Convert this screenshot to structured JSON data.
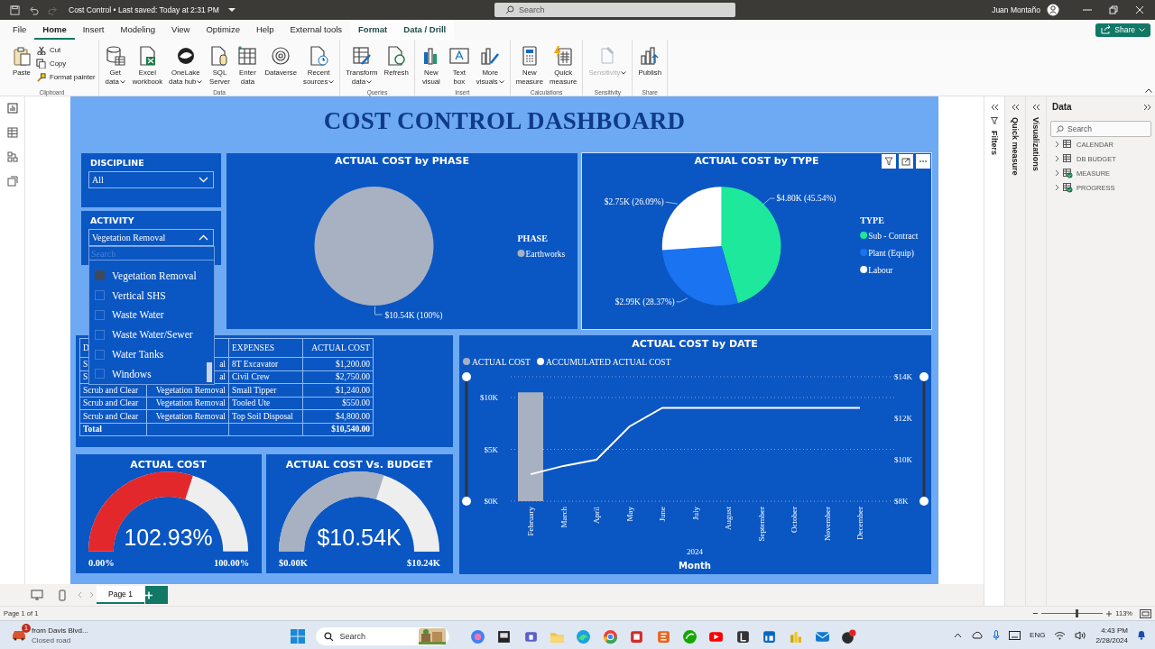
{
  "window": {
    "title": "Cost Control • Last saved: Today at 2:31 PM",
    "search_placeholder": "Search",
    "user": "Juan Montaño"
  },
  "menu_tabs": [
    {
      "label": "File",
      "selected": false,
      "contextual": false
    },
    {
      "label": "Home",
      "selected": true,
      "contextual": false
    },
    {
      "label": "Insert",
      "selected": false,
      "contextual": false
    },
    {
      "label": "Modeling",
      "selected": false,
      "contextual": false
    },
    {
      "label": "View",
      "selected": false,
      "contextual": false
    },
    {
      "label": "Optimize",
      "selected": false,
      "contextual": false
    },
    {
      "label": "Help",
      "selected": false,
      "contextual": false
    },
    {
      "label": "External tools",
      "selected": false,
      "contextual": false
    },
    {
      "label": "Format",
      "selected": false,
      "contextual": true
    },
    {
      "label": "Data / Drill",
      "selected": false,
      "contextual": true
    }
  ],
  "share_button": "Share",
  "ribbon_groups": [
    {
      "name": "Clipboard",
      "buttons": [
        {
          "label": "Paste",
          "kind": "large",
          "menu": false,
          "disabled": false
        },
        {
          "label": "Cut",
          "kind": "small",
          "menu": false,
          "disabled": false
        },
        {
          "label": "Copy",
          "kind": "small",
          "menu": false,
          "disabled": false
        },
        {
          "label": "Format painter",
          "kind": "small",
          "menu": false,
          "disabled": false
        }
      ]
    },
    {
      "name": "Data",
      "buttons": [
        {
          "label": "Get\ndata",
          "kind": "large",
          "menu": true,
          "disabled": false
        },
        {
          "label": "Excel\nworkbook",
          "kind": "large",
          "menu": false,
          "disabled": false
        },
        {
          "label": "OneLake\ndata hub",
          "kind": "large",
          "menu": true,
          "disabled": false
        },
        {
          "label": "SQL\nServer",
          "kind": "large",
          "menu": false,
          "disabled": false
        },
        {
          "label": "Enter\ndata",
          "kind": "large",
          "menu": false,
          "disabled": false
        },
        {
          "label": "Dataverse",
          "kind": "large",
          "menu": false,
          "disabled": false
        },
        {
          "label": "Recent\nsources",
          "kind": "large",
          "menu": true,
          "disabled": false
        }
      ]
    },
    {
      "name": "Queries",
      "buttons": [
        {
          "label": "Transform\ndata",
          "kind": "large",
          "menu": true,
          "disabled": false
        },
        {
          "label": "Refresh",
          "kind": "large",
          "menu": false,
          "disabled": false
        }
      ]
    },
    {
      "name": "Insert",
      "buttons": [
        {
          "label": "New\nvisual",
          "kind": "large",
          "menu": false,
          "disabled": false
        },
        {
          "label": "Text\nbox",
          "kind": "large",
          "menu": false,
          "disabled": false
        },
        {
          "label": "More\nvisuals",
          "kind": "large",
          "menu": true,
          "disabled": false
        }
      ]
    },
    {
      "name": "Calculations",
      "buttons": [
        {
          "label": "New\nmeasure",
          "kind": "large",
          "menu": false,
          "disabled": false
        },
        {
          "label": "Quick\nmeasure",
          "kind": "large",
          "menu": false,
          "disabled": false
        }
      ]
    },
    {
      "name": "Sensitivity",
      "buttons": [
        {
          "label": "Sensitivity",
          "kind": "large",
          "menu": true,
          "disabled": true
        }
      ]
    },
    {
      "name": "Share",
      "buttons": [
        {
          "label": "Publish",
          "kind": "large",
          "menu": false,
          "disabled": false
        }
      ]
    }
  ],
  "report": {
    "title": "COST CONTROL DASHBOARD",
    "slicers": [
      {
        "title": "DISCIPLINE",
        "value": "All",
        "expanded": false
      },
      {
        "title": "ACTIVITY",
        "value": "Vegetation Removal",
        "expanded": true,
        "search_placeholder": "Search",
        "options": [
          {
            "label": "Vegetation Removal",
            "checked": true
          },
          {
            "label": "Vertical SHS",
            "checked": false
          },
          {
            "label": "Waste Water",
            "checked": false
          },
          {
            "label": "Waste Water/Sewer",
            "checked": false
          },
          {
            "label": "Water Tanks",
            "checked": false
          },
          {
            "label": "Windows",
            "checked": false
          }
        ]
      }
    ],
    "pie_visuals": [
      {
        "focused": false,
        "chart_data": {
          "type": "pie",
          "title": "ACTUAL COST by PHASE",
          "categories": [
            "Earthworks"
          ],
          "values": [
            100
          ],
          "colors": [
            "#a7b1c2"
          ],
          "value_labels": [
            "$10.54K (100%)"
          ],
          "legend": {
            "title": "PHASE"
          }
        }
      },
      {
        "focused": true,
        "chart_data": {
          "type": "pie",
          "title": "ACTUAL COST by TYPE",
          "categories": [
            "Sub - Contract",
            "Plant (Equip)",
            "Labour"
          ],
          "values": [
            45.54,
            28.37,
            26.09
          ],
          "colors": [
            "#1de89b",
            "#1a73f0",
            "#ffffff"
          ],
          "value_labels": [
            "$4.80K (45.54%)",
            "$2.99K (28.37%)",
            "$2.75K (26.09%)"
          ],
          "legend": {
            "title": "TYPE"
          }
        }
      }
    ],
    "table": {
      "columns": [
        "D",
        "",
        "EXPENSES",
        "ACTUAL COST"
      ],
      "rows": [
        [
          "S",
          "al",
          "8T Excavator",
          "$1,200.00"
        ],
        [
          "S",
          "al",
          "Civil Crew",
          "$2,750.00"
        ],
        [
          "Scrub and Clear",
          "Vegetation Removal",
          "Small Tipper",
          "$1,240.00"
        ],
        [
          "Scrub and Clear",
          "Vegetation Removal",
          "Tooled Ute",
          "$550.00"
        ],
        [
          "Scrub and Clear",
          "Vegetation Removal",
          "Top Soil Disposal",
          "$4,800.00"
        ]
      ],
      "total": {
        "label": "Total",
        "value": "$10,540.00"
      }
    },
    "gauges": [
      {
        "title": "ACTUAL COST",
        "value": "102.93%",
        "min": "0.00%",
        "max": "100.00%",
        "level": 0.6,
        "color": "#e3282b"
      },
      {
        "title": "ACTUAL COST Vs. BUDGET",
        "value": "$10.54K",
        "min": "$0.00K",
        "max": "$10.24K",
        "level": 0.6,
        "color": "#a7b1c2"
      }
    ],
    "date_chart": {
      "year_label": "2024",
      "chart_data": {
        "type": "bar",
        "title": "ACTUAL COST by DATE",
        "xlabel": "Month",
        "categories": [
          "February",
          "March",
          "April",
          "May",
          "June",
          "July",
          "August",
          "September",
          "October",
          "November",
          "December"
        ],
        "series": [
          {
            "name": "ACTUAL COST",
            "color": "#a7b1c2",
            "type": "bar",
            "values": [
              10.5,
              null,
              null,
              null,
              null,
              null,
              null,
              null,
              null,
              null,
              null
            ]
          },
          {
            "name": "ACCUMULATED ACTUAL COST",
            "color": "#ffffff",
            "axis": "y2",
            "type": "line",
            "values": [
              9.3,
              9.7,
              10.0,
              11.6,
              12.5,
              12.5,
              12.5,
              12.5,
              12.5,
              12.5,
              12.5
            ]
          }
        ],
        "legend": "top",
        "ylim": [
          0,
          12
        ],
        "y2lim": [
          8,
          14
        ],
        "yticks": [
          {
            "value": 0,
            "label": "$0K"
          },
          {
            "value": 5,
            "label": "$5K"
          },
          {
            "value": 10,
            "label": "$10K"
          }
        ],
        "y2ticks": [
          {
            "value": 8,
            "label": "$8K"
          },
          {
            "value": 10,
            "label": "$10K"
          },
          {
            "value": 12,
            "label": "$12K"
          },
          {
            "value": 14,
            "label": "$14K"
          }
        ]
      }
    }
  },
  "collapsed_panes": [
    "Filters",
    "Quick measure",
    "Visualizations"
  ],
  "data_pane": {
    "title": "Data",
    "search_placeholder": "Search",
    "tables": [
      {
        "name": "CALENDAR",
        "badge": false
      },
      {
        "name": "DB BUDGET",
        "badge": false
      },
      {
        "name": "MEASURE",
        "badge": true
      },
      {
        "name": "PROGRESS",
        "badge": true
      }
    ]
  },
  "page_tabs": [
    {
      "label": "Page 1",
      "selected": true
    }
  ],
  "status_bar": {
    "page_info": "Page 1 of 1",
    "zoom": {
      "reading": "113%",
      "level": 0.55
    }
  },
  "taskbar": {
    "notification": {
      "title": "from Davis Blvd...",
      "subtitle": "Closed road",
      "count": "1"
    },
    "search_placeholder": "Search",
    "language": "ENG",
    "time": "4:43 PM",
    "date": "2/28/2024"
  }
}
